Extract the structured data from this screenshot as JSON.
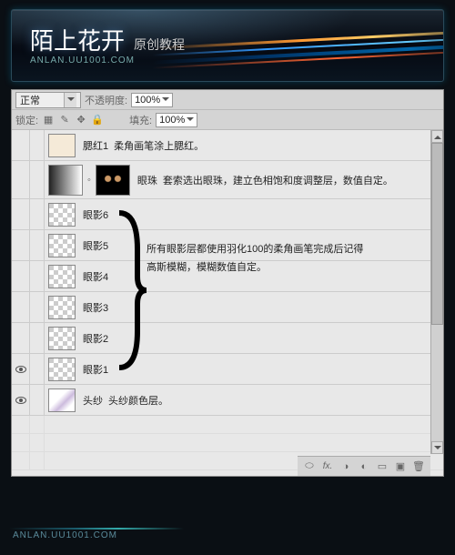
{
  "banner": {
    "title": "陌上花开",
    "subtitle": "原创教程",
    "url": "ANLAN.UU1001.COM"
  },
  "toolbar": {
    "blend_mode": "正常",
    "opacity_label": "不透明度:",
    "opacity_value": "100%",
    "lock_label": "锁定:",
    "fill_label": "填充:",
    "fill_value": "100%"
  },
  "layers": [
    {
      "name": "腮红1",
      "desc": "柔角画笔涂上腮红。",
      "thumb": "peach",
      "tall": false
    },
    {
      "name": "眼珠",
      "desc": "套索选出眼珠，建立色相饱和度调整层，数值自定。",
      "thumb": "adjust",
      "tall": true
    },
    {
      "name": "眼影6",
      "desc": "",
      "thumb": "checker",
      "tall": false
    },
    {
      "name": "眼影5",
      "desc": "",
      "thumb": "checker",
      "tall": false
    },
    {
      "name": "眼影4",
      "desc": "",
      "thumb": "checker",
      "tall": false
    },
    {
      "name": "眼影3",
      "desc": "",
      "thumb": "checker",
      "tall": false
    },
    {
      "name": "眼影2",
      "desc": "",
      "thumb": "checker",
      "tall": false
    },
    {
      "name": "眼影1",
      "desc": "",
      "thumb": "checker",
      "tall": false
    },
    {
      "name": "头纱",
      "desc": "头纱颜色层。",
      "thumb": "veil",
      "tall": false
    }
  ],
  "annotation": {
    "line1": "所有眼影层都使用羽化100的柔角画笔完成后记得",
    "line2": "高斯模糊，模糊数值自定。"
  },
  "footer": {
    "url": "ANLAN.UU1001.COM"
  }
}
